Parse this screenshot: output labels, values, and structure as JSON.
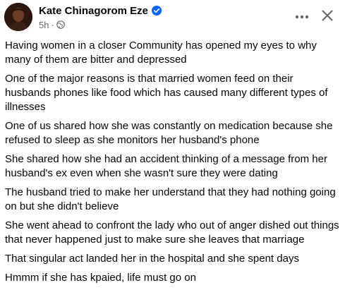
{
  "post": {
    "author": "Kate Chinagorom Eze",
    "verified_icon": "verified-badge-icon",
    "time": "5h",
    "separator": "·",
    "audience_icon": "globe-icon",
    "more_icon": "more-options-icon",
    "close_icon": "close-icon",
    "paragraphs": [
      "Having women in a closer Community has opened my eyes to why many of them are bitter and depressed",
      "One of the major reasons is that married women feed on their husbands phones like food which has caused many different types of illnesses",
      "One of us shared how she was constantly  on medication because she refused to sleep as she monitors her husband's phone",
      "She shared how she had an accident thinking of a message from her husband's ex even when she wasn't sure they were dating",
      "The husband tried to make her understand that they had nothing going on but she didn't believe",
      "She went ahead to confront the lady who out of anger dished out things that never happened just to make sure she leaves that marriage",
      "That singular act landed her in the hospital and she spent days",
      "Hmmm if she has kpaied, life must go on"
    ]
  },
  "colors": {
    "text": "#050505",
    "secondary_text": "#65676b",
    "verified_blue": "#0866ff",
    "background": "#ffffff"
  }
}
